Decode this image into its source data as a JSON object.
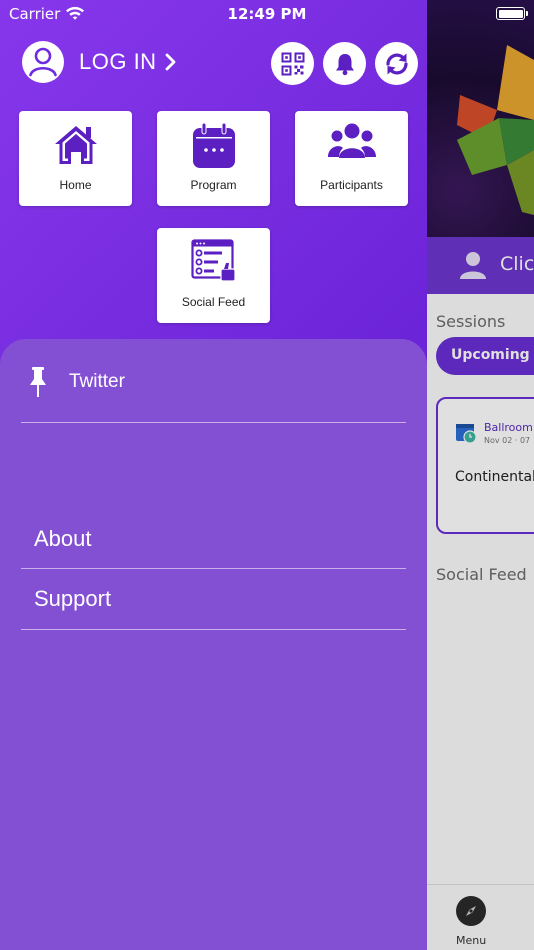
{
  "status_bar": {
    "carrier": "Carrier",
    "time": "12:49 PM"
  },
  "drawer": {
    "login_label": "LOG IN",
    "tiles": [
      {
        "label": "Home",
        "icon": "home-icon"
      },
      {
        "label": "Program",
        "icon": "calendar-icon"
      },
      {
        "label": "Participants",
        "icon": "people-icon"
      },
      {
        "label": "Social Feed",
        "icon": "social-feed-icon"
      }
    ],
    "menu": {
      "pinned_item": "Twitter",
      "about": "About",
      "support": "Support"
    }
  },
  "background_app": {
    "user_prompt": "Clic",
    "sessions_title": "Sessions",
    "upcoming_pill": "Upcoming S",
    "session_card": {
      "room": "Ballroom",
      "date": "Nov 02 · 07",
      "title": "Continental"
    },
    "social_feed_title": "Social Feed",
    "tab_menu": "Menu"
  },
  "colors": {
    "drawer_gradient_start": "#8737eb",
    "drawer_gradient_end": "#5a1cc8",
    "menu_panel": "#8350d4",
    "icon_purple": "#5b1fc2"
  }
}
